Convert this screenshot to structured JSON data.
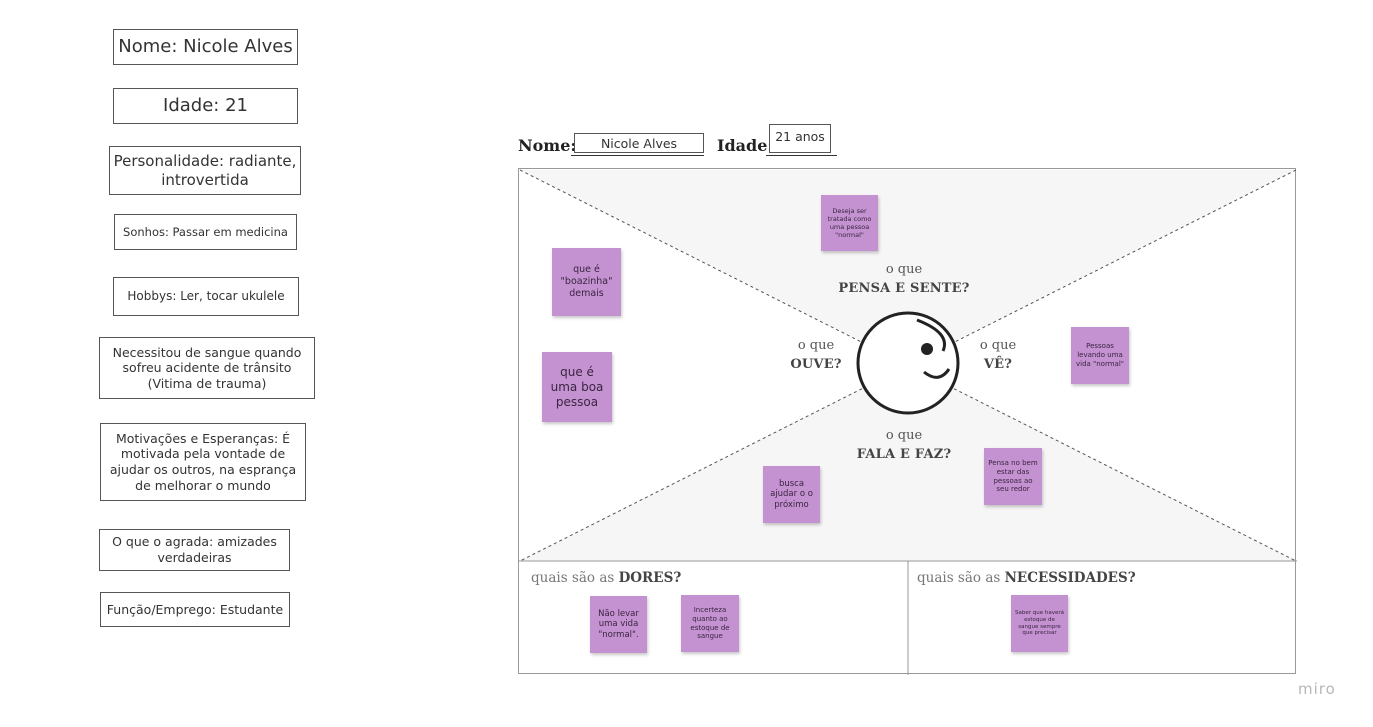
{
  "persona_cards": [
    {
      "id": "nome",
      "text": "Nome: Nicole Alves"
    },
    {
      "id": "idade",
      "text": "Idade: 21"
    },
    {
      "id": "personalidade",
      "text": "Personalidade: radiante, introvertida"
    },
    {
      "id": "sonhos",
      "text": "Sonhos: Passar em medicina"
    },
    {
      "id": "hobbys",
      "text": "Hobbys: Ler, tocar ukulele"
    },
    {
      "id": "sangue",
      "text": "Necessitou de sangue quando sofreu acidente de trânsito (Vitima de trauma)"
    },
    {
      "id": "motivacoes",
      "text": "Motivações e Esperanças: É motivada pela vontade de ajudar os outros, na esprança de melhorar o mundo"
    },
    {
      "id": "agrada",
      "text": "O que o agrada: amizades verdadeiras"
    },
    {
      "id": "funcao",
      "text": "Função/Emprego: Estudante"
    }
  ],
  "header": {
    "nome_label": "Nome:",
    "nome_value": "Nicole Alves",
    "idade_label": "Idade:",
    "idade_value": "21 anos"
  },
  "quadrants": {
    "pensa": {
      "prefix": "o que",
      "title": "PENSA E SENTE?"
    },
    "ouve": {
      "prefix": "o que",
      "title": "OUVE?"
    },
    "ve": {
      "prefix": "o que",
      "title": "VÊ?"
    },
    "fala": {
      "prefix": "o que",
      "title": "FALA E FAZ?"
    }
  },
  "sections": {
    "dores": {
      "prefix": "quais são as",
      "title": "DORES?"
    },
    "necessidades": {
      "prefix": "quais são as",
      "title": "NECESSIDADES?"
    }
  },
  "stickies": {
    "pensa_1": "Deseja ser tratada como uma pessoa \"normal\"",
    "ouve_1": "que é \"boazinha\" demais",
    "ouve_2": "que é uma boa pessoa",
    "ve_1": "Pessoas levando uma vida \"normal\"",
    "fala_1": "busca ajudar o o próximo",
    "fala_2": "Pensa no bem estar das pessoas ao seu redor",
    "dores_1": "Não levar uma vida \"normal\".",
    "dores_2": "Incerteza quanto ao estoque de sangue",
    "nec_1": "Saber que haverá estoque de sangue sempre que precisar"
  },
  "colors": {
    "sticky": "#c492d1",
    "board_fill": "#f6f6f6"
  },
  "brand": "miro"
}
